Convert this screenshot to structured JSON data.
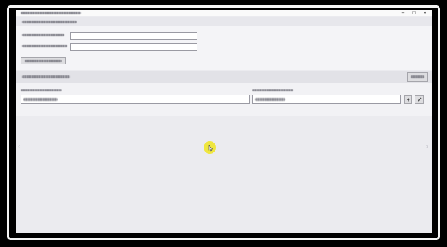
{
  "window": {
    "title": "",
    "controls": {
      "minimize": "–",
      "maximize": "□",
      "close": "×"
    }
  },
  "section1": {
    "header": "",
    "fields": [
      {
        "label": "",
        "value": ""
      },
      {
        "label": "",
        "value": ""
      }
    ],
    "button_label": ""
  },
  "section2": {
    "header": "",
    "right_button_label": "",
    "columns": [
      {
        "label": "",
        "value": ""
      },
      {
        "label": "",
        "value": ""
      }
    ],
    "add_label": "+",
    "edit_icon": "pencil-icon"
  },
  "nav": {
    "prev": "‹",
    "next": "›"
  },
  "colors": {
    "cursor_highlight": "#f0e62c",
    "background": "#ebebef"
  }
}
